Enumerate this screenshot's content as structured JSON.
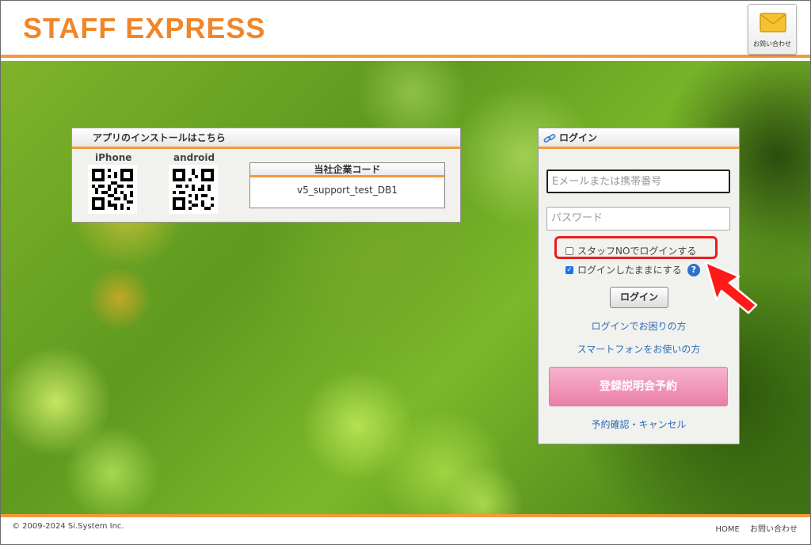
{
  "header": {
    "logo_text": "STAFF EXPRESS",
    "contact_button_label": "お問い合わせ"
  },
  "app_install": {
    "title": "アプリのインストールはこちら",
    "iphone_label": "iPhone",
    "android_label": "android",
    "company_code_title": "当社企業コード",
    "company_code_value": "v5_support_test_DB1"
  },
  "login": {
    "title": "ログイン",
    "email_placeholder": "Eメールまたは携帯番号",
    "password_placeholder": "パスワード",
    "staff_no_checkbox_label": "スタッフNOでログインする",
    "staff_no_checked": false,
    "remember_checkbox_label": "ログインしたままにする",
    "remember_checked": true,
    "help_icon_glyph": "?",
    "login_button_label": "ログイン",
    "trouble_link": "ログインでお困りの方",
    "smartphone_link": "スマートフォンをお使いの方",
    "reserve_button_label": "登録説明会予約",
    "reservation_link": "予約確認・キャンセル"
  },
  "annotation": {
    "highlight_color": "#e81e1e",
    "arrow_color": "#ff1a1a"
  },
  "footer": {
    "copyright": "© 2009-2024 Si.System Inc.",
    "home_link": "HOME",
    "contact_link": "お問い合わせ"
  },
  "colors": {
    "brand_orange": "#f0862a",
    "accent_bar": "#f49a3a",
    "link_blue": "#2c6db8",
    "reserve_pink": "#ea7ea9"
  }
}
